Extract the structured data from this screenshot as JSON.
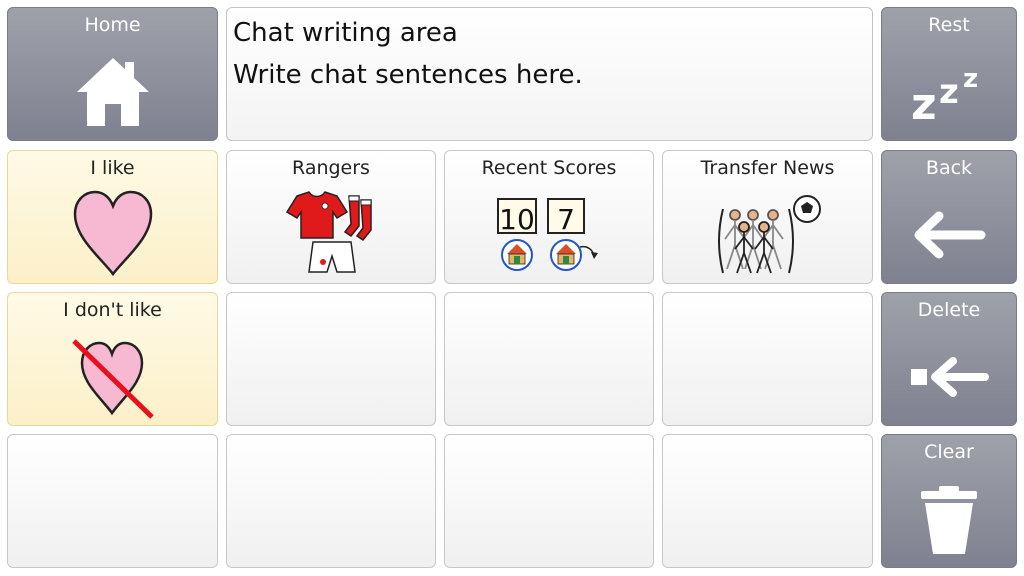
{
  "left_column": {
    "home": {
      "label": "Home",
      "icon": "home-icon"
    },
    "i_like": {
      "label": "I like",
      "icon": "heart-icon"
    },
    "i_dont_like": {
      "label": "I don't like",
      "icon": "crossed-heart-icon"
    }
  },
  "chat_area": {
    "line1": "Chat writing area",
    "line2": "Write chat sentences here."
  },
  "grid": {
    "rangers": {
      "label": "Rangers",
      "icon": "football-kit-icon"
    },
    "recent_scores": {
      "label": "Recent Scores",
      "icon": "scoreboard-icon",
      "home_score": "10",
      "away_score": "7"
    },
    "transfer_news": {
      "label": "Transfer News",
      "icon": "players-transfer-icon"
    }
  },
  "right_column": {
    "rest": {
      "label": "Rest",
      "icon": "sleep-zzz-icon"
    },
    "back": {
      "label": "Back",
      "icon": "arrow-left-icon"
    },
    "delete": {
      "label": "Delete",
      "icon": "backspace-icon"
    },
    "clear": {
      "label": "Clear",
      "icon": "trash-icon"
    }
  },
  "colors": {
    "nav_grey": "#8d8f9c",
    "feeling_yellow": "#fdf5d8",
    "cell_white": "#f7f7f7",
    "heart_pink": "#f7b8d2",
    "kit_red": "#e01a1a",
    "cross_red": "#e8101a"
  }
}
